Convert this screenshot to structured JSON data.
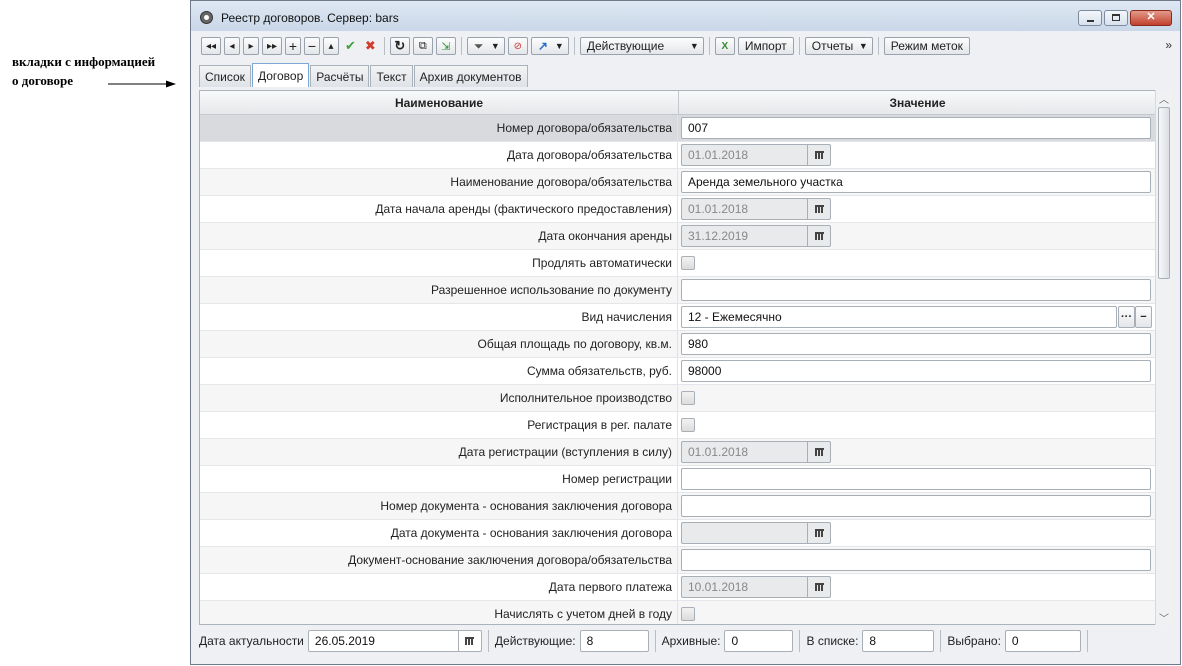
{
  "annotation": {
    "line1": "вкладки с информацией",
    "line2": "о договоре"
  },
  "window": {
    "title": "Реестр договоров. Сервер: bars"
  },
  "toolbar": {
    "status_select": "Действующие",
    "import_label": "Импорт",
    "reports_label": "Отчеты",
    "mark_mode_label": "Режим меток",
    "more": "»"
  },
  "tabs": [
    {
      "label": "Список"
    },
    {
      "label": "Договор"
    },
    {
      "label": "Расчёты"
    },
    {
      "label": "Текст"
    },
    {
      "label": "Архив документов"
    }
  ],
  "grid": {
    "col_name": "Наименование",
    "col_value": "Значение",
    "rows": [
      {
        "label": "Номер договора/обязательства",
        "value": "007"
      },
      {
        "label": "Дата договора/обязательства",
        "value": "01.01.2018"
      },
      {
        "label": "Наименование договора/обязательства",
        "value": "Аренда земельного участка"
      },
      {
        "label": "Дата начала аренды (фактического предоставления)",
        "value": "01.01.2018"
      },
      {
        "label": "Дата окончания аренды",
        "value": "31.12.2019"
      },
      {
        "label": "Продлять автоматически",
        "value": ""
      },
      {
        "label": "Разрешенное использование по документу",
        "value": ""
      },
      {
        "label": "Вид начисления",
        "value": "12 - Ежемесячно"
      },
      {
        "label": "Общая площадь по договору, кв.м.",
        "value": "980"
      },
      {
        "label": "Сумма обязательств, руб.",
        "value": "98000"
      },
      {
        "label": "Исполнительное производство",
        "value": ""
      },
      {
        "label": "Регистрация в рег. палате",
        "value": ""
      },
      {
        "label": "Дата регистрации (вступления в силу)",
        "value": "01.01.2018"
      },
      {
        "label": "Номер регистрации",
        "value": ""
      },
      {
        "label": "Номер документа - основания заключения договора",
        "value": ""
      },
      {
        "label": "Дата документа - основания заключения договора",
        "value": ""
      },
      {
        "label": "Документ-основание заключения договора/обязательства",
        "value": ""
      },
      {
        "label": "Дата первого платежа",
        "value": "10.01.2018"
      },
      {
        "label": "Начислять с учетом  дней в году",
        "value": ""
      }
    ]
  },
  "status": {
    "actuality_label": "Дата актуальности",
    "actuality_value": "26.05.2019",
    "active_label": "Действующие:",
    "active_value": "8",
    "archive_label": "Архивные:",
    "archive_value": "0",
    "inlist_label": "В списке:",
    "inlist_value": "8",
    "selected_label": "Выбрано:",
    "selected_value": "0"
  }
}
